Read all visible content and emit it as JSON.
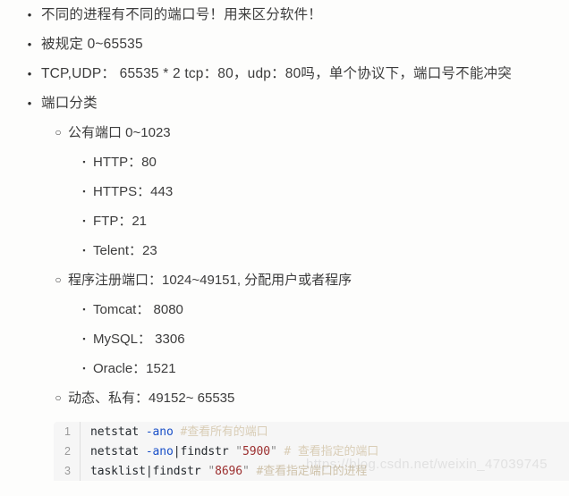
{
  "page": {
    "background": "#fdfdfc",
    "text_color": "#3c3c3c"
  },
  "bullets": {
    "level1": "•",
    "level2": "○",
    "level3": "▪"
  },
  "outline": {
    "items": [
      {
        "text": "不同的进程有不同的端口号！用来区分软件！"
      },
      {
        "text": "被规定 0~65535"
      },
      {
        "text": "TCP,UDP：  65535 * 2  tcp：80，udp：80吗，单个协议下，端口号不能冲突"
      },
      {
        "text": "端口分类"
      }
    ],
    "categories": [
      {
        "text": "公有端口 0~1023",
        "children": [
          {
            "text": "HTTP：80"
          },
          {
            "text": "HTTPS：443"
          },
          {
            "text": "FTP：21"
          },
          {
            "text": "Telent：23"
          }
        ]
      },
      {
        "text": "程序注册端口：1024~49151, 分配用户或者程序",
        "children": [
          {
            "text": "Tomcat：  8080"
          },
          {
            "text": "MySQL：  3306"
          },
          {
            "text": "Oracle：1521"
          }
        ]
      },
      {
        "text": "动态、私有：49152~ 65535",
        "children": []
      }
    ]
  },
  "codeblock": {
    "background": "#f6f6f6",
    "lines": [
      {
        "number": "1",
        "tokens": [
          {
            "t": "netstat ",
            "c": "tok-plain"
          },
          {
            "t": "-ano",
            "c": "tok-flag"
          },
          {
            "t": " ",
            "c": "tok-plain"
          },
          {
            "t": "#查看所有的端口",
            "c": "tok-cmt"
          }
        ]
      },
      {
        "number": "2",
        "tokens": [
          {
            "t": "netstat ",
            "c": "tok-plain"
          },
          {
            "t": "-ano",
            "c": "tok-flag"
          },
          {
            "t": "|findstr ",
            "c": "tok-plain"
          },
          {
            "t": "\"",
            "c": "tok-quote"
          },
          {
            "t": "5900",
            "c": "tok-num"
          },
          {
            "t": "\"",
            "c": "tok-quote"
          },
          {
            "t": " ",
            "c": "tok-plain"
          },
          {
            "t": "# 查看指定的端口",
            "c": "tok-cmt"
          }
        ]
      },
      {
        "number": "3",
        "tokens": [
          {
            "t": "tasklist|findstr ",
            "c": "tok-plain"
          },
          {
            "t": "\"",
            "c": "tok-quote"
          },
          {
            "t": "8696",
            "c": "tok-num"
          },
          {
            "t": "\"",
            "c": "tok-quote"
          },
          {
            "t": " ",
            "c": "tok-plain"
          },
          {
            "t": "#查看指定端口的进程",
            "c": "tok-cmt"
          }
        ]
      }
    ]
  },
  "watermark": {
    "text": "https://blog.csdn.net/weixin_47039745"
  }
}
